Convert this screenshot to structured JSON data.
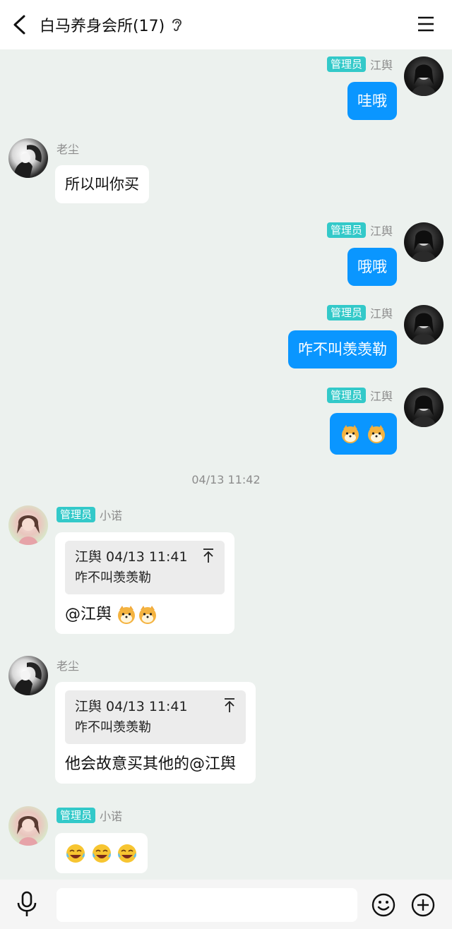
{
  "header": {
    "title": "白马养身会所(17)"
  },
  "messages": {
    "m1": {
      "badge": "管理员",
      "sender": "江舆",
      "text": "哇哦"
    },
    "m2": {
      "sender": "老尘",
      "text": "所以叫你买"
    },
    "m3": {
      "badge": "管理员",
      "sender": "江舆",
      "text": "哦哦"
    },
    "m4": {
      "badge": "管理员",
      "sender": "江舆",
      "text": "咋不叫羡羡勒"
    },
    "m5": {
      "badge": "管理员",
      "sender": "江舆",
      "emojis": [
        "dog-emoji",
        "dog-emoji"
      ]
    },
    "timestamp": "04/13 11:42",
    "m6": {
      "badge": "管理员",
      "sender": "小诺",
      "quote_head": "江舆 04/13 11:41",
      "quote_text": "咋不叫羡羡勒",
      "text": "@江舆"
    },
    "m7": {
      "sender": "老尘",
      "quote_head": "江舆 04/13 11:41",
      "quote_text": "咋不叫羡羡勒",
      "text": "他会故意买其他的@江舆"
    },
    "m8": {
      "badge": "管理员",
      "sender": "小诺",
      "emojis": [
        "laugh-cry-emoji",
        "laugh-cry-emoji",
        "laugh-cry-emoji"
      ]
    }
  },
  "footer": {
    "input_placeholder": ""
  },
  "colors": {
    "accent_blue": "#0a96ff",
    "badge": "#33c9c9",
    "background": "#ecf1ee"
  },
  "icons": {
    "back": "back-arrow-icon",
    "ear": "ear-icon",
    "menu": "menu-icon",
    "mic": "microphone-icon",
    "smile": "emoji-icon",
    "plus": "plus-icon",
    "pin": "scroll-to-top-icon"
  }
}
